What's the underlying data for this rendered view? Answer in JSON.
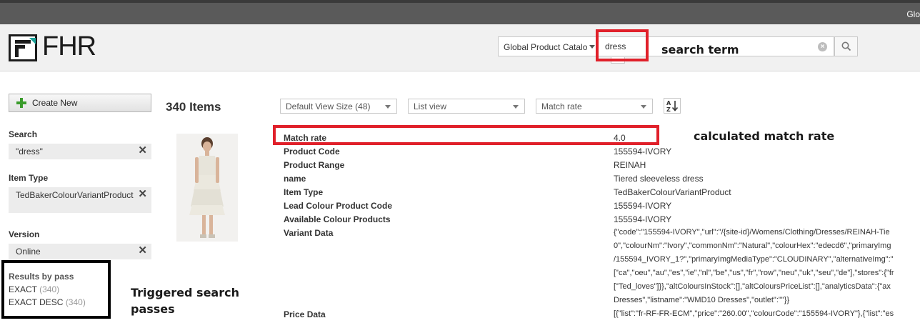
{
  "topbar": {
    "user_label": "Glo"
  },
  "header": {
    "logo_text": "FHR",
    "catalog_select": "Global Product Catalo",
    "search": {
      "value": "dress",
      "placeholder": ""
    }
  },
  "sidebar": {
    "create_label": "Create New",
    "facets": [
      {
        "label": "Search",
        "value": "\"dress\""
      },
      {
        "label": "Item Type",
        "value": "TedBakerColourVariantProduct"
      },
      {
        "label": "Version",
        "value": "Online"
      }
    ],
    "passes": {
      "title": "Results by pass",
      "items": [
        {
          "name": "EXACT",
          "count": "(340)"
        },
        {
          "name": "EXACT DESC",
          "count": "(340)"
        }
      ]
    }
  },
  "toolbar": {
    "items_count": "340 Items",
    "view_size": "Default View Size (48)",
    "view_mode": "List view",
    "sort": "Match rate"
  },
  "product": {
    "attributes": [
      {
        "name": "Match rate",
        "value": "4.0"
      },
      {
        "name": "Product Code",
        "value": "155594-IVORY"
      },
      {
        "name": "Product Range",
        "value": "REINAH"
      },
      {
        "name": "name",
        "value": "Tiered sleeveless dress"
      },
      {
        "name": "Item Type",
        "value": "TedBakerColourVariantProduct"
      },
      {
        "name": "Lead Colour Product Code",
        "value": "155594-IVORY"
      },
      {
        "name": "Available Colour Products",
        "value": "155594-IVORY"
      }
    ],
    "variant_label": "Variant Data",
    "variant_lines": [
      "{\"code\":\"155594-IVORY\",\"url\":\"/{site-id}/Womens/Clothing/Dresses/REINAH-Tie",
      "0\",\"colourNm\":\"Ivory\",\"commonNm\":\"Natural\",\"colourHex\":\"edecd6\",\"primaryImg",
      "/155594_IVORY_1?\",\"primaryImgMediaType\":\"CLOUDINARY\",\"alternativeImg\":\"",
      "[\"ca\",\"oeu\",\"au\",\"es\",\"ie\",\"nl\",\"be\",\"us\",\"fr\",\"row\",\"neu\",\"uk\",\"seu\",\"de\"],\"stores\":{\"fr",
      "[\"Ted_loves\"]}},\"altColoursInStock\":[],\"altColoursPriceList\":[],\"analyticsData\":{\"ax",
      "Dresses\",\"listname\":\"WMD10 Dresses\",\"outlet\":\"\"}}"
    ],
    "price_label": "Price Data",
    "price_line": "[{\"list\":\"fr-RF-FR-ECM\",\"price\":\"260.00\",\"colourCode\":\"155594-IVORY\"},{\"list\":\"es"
  },
  "annotations": {
    "search_term": "search term",
    "match_rate": "calculated match rate",
    "passes_line1": "Triggered search",
    "passes_line2": "passes"
  },
  "colors": {
    "accent_red": "#e0202a",
    "brand_teal": "#1aa39a",
    "create_green": "#3a9b2b"
  },
  "icons": [
    "plus-icon",
    "close-icon",
    "clear-icon",
    "search-icon",
    "sort-az-icon",
    "caret-down-icon"
  ]
}
